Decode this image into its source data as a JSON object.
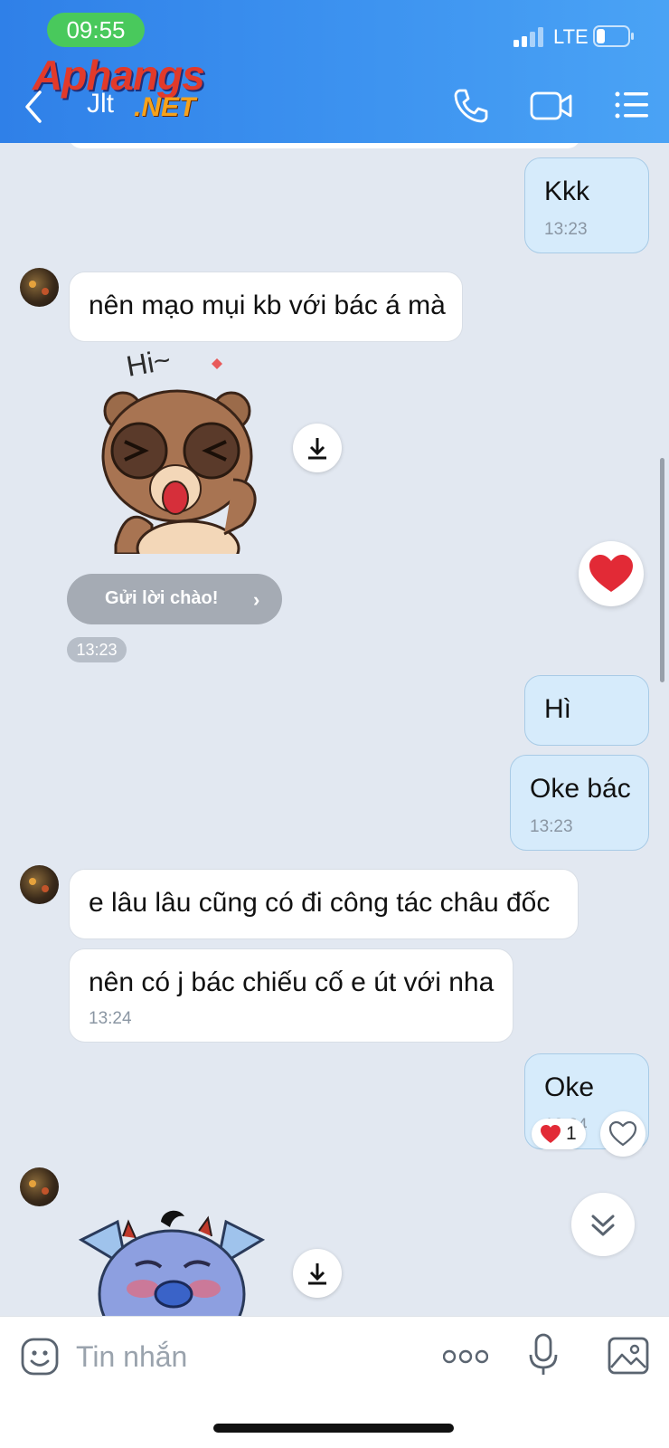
{
  "status_bar": {
    "time": "09:55",
    "network": "LTE"
  },
  "header": {
    "contact_name": "Jlt",
    "watermark_main": "Aphangs",
    "watermark_sub": ".NET"
  },
  "messages": [
    {
      "side": "out",
      "text": "Kkk",
      "time": "13:23"
    },
    {
      "side": "in",
      "text": "nên mạo mụi kb với bác á mà"
    },
    {
      "side": "in",
      "type": "sticker",
      "sticker_text": "Hi~",
      "name": "bear-sticker"
    },
    {
      "side": "out",
      "text": "Hì"
    },
    {
      "side": "out",
      "text": "Oke bác",
      "time": "13:23"
    },
    {
      "side": "in",
      "text": "e lâu lâu cũng có đi công tác châu đốc"
    },
    {
      "side": "in",
      "text": "nên có j bác chiếu cố e út với nha",
      "time": "13:24"
    },
    {
      "side": "out",
      "text": "Oke",
      "time": "13:24",
      "reaction_count": "1"
    },
    {
      "side": "in",
      "type": "sticker",
      "name": "blue-monster-sticker"
    }
  ],
  "sticker_greeting": {
    "button_label": "Gửi lời chào!",
    "chevron": "›",
    "time": "13:23"
  },
  "composer": {
    "placeholder": "Tin nhắn"
  },
  "colors": {
    "header": "#3d93f0",
    "outgoing_bubble": "#d6ebfb",
    "incoming_bubble": "#ffffff",
    "chat_bg": "#e2e8f1"
  },
  "icons": [
    "back-icon",
    "phone-icon",
    "video-icon",
    "menu-icon",
    "download-icon",
    "heart-icon",
    "chevron-down-icon",
    "emoji-icon",
    "more-icon",
    "microphone-icon",
    "image-icon"
  ]
}
